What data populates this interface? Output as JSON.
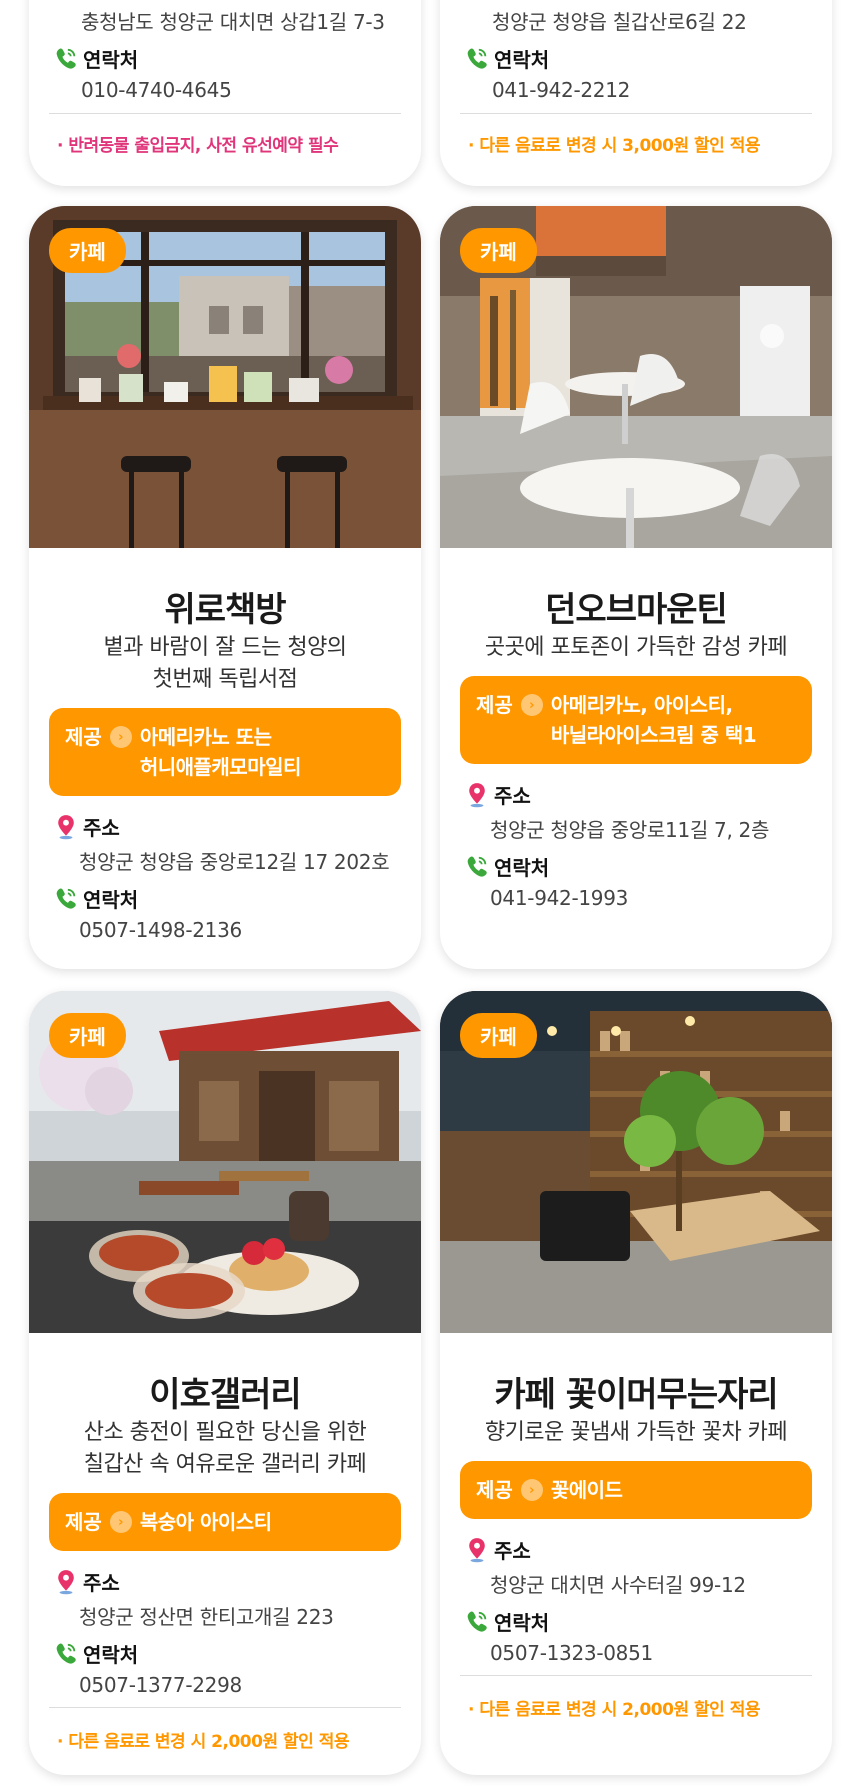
{
  "labels": {
    "offer": "제공",
    "address": "주소",
    "contact": "연락처"
  },
  "top_left": {
    "address": "충청남도 청양군 대치면 상갑1길 7-3",
    "phone": "010-4740-4645",
    "note": "· 반려동물 출입금지, 사전 유선예약 필수"
  },
  "top_right": {
    "address": "청양군 청양읍 칠갑산로6길 22",
    "phone": "041-942-2212",
    "note": "· 다른 음료로 변경 시 3,000원 할인 적용"
  },
  "cards": [
    {
      "tag": "카페",
      "title": "위로책방",
      "desc": [
        "볕과 바람이 잘 드는 청양의",
        "첫번째 독립서점"
      ],
      "offer": [
        "아메리카노 또는",
        "허니애플캐모마일티"
      ],
      "address": "청양군 청양읍 중앙로12길 17 202호",
      "phone": "0507-1498-2136"
    },
    {
      "tag": "카페",
      "title": "던오브마운틴",
      "desc": [
        "곳곳에 포토존이 가득한 감성 카페"
      ],
      "offer": [
        "아메리카노, 아이스티,",
        "바닐라아이스크림 중 택1"
      ],
      "address": "청양군 청양읍 중앙로11길 7, 2층",
      "phone": "041-942-1993"
    },
    {
      "tag": "카페",
      "title": "이호갤러리",
      "desc": [
        "산소 충전이 필요한 당신을 위한",
        "칠갑산 속 여유로운 갤러리 카페"
      ],
      "offer": [
        "복숭아 아이스티"
      ],
      "address": "청양군 정산면 한티고개길 223",
      "phone": "0507-1377-2298",
      "note": "· 다른 음료로 변경 시 2,000원 할인 적용"
    },
    {
      "tag": "카페",
      "title": "카페 꽃이머무는자리",
      "desc": [
        "향기로운 꽃냄새 가득한 꽃차 카페"
      ],
      "offer": [
        "꽃에이드"
      ],
      "address": "청양군 대치면 사수터길 99-12",
      "phone": "0507-1323-0851",
      "note": "· 다른 음료로 변경 시 2,000원 할인 적용"
    }
  ],
  "colors": {
    "accent": "#ff9800",
    "pink": "#e0357a",
    "pin": "#e8336a",
    "phone": "#3aa83a"
  },
  "icons": [
    "location-pin-icon",
    "phone-icon",
    "arrow-right-icon"
  ]
}
